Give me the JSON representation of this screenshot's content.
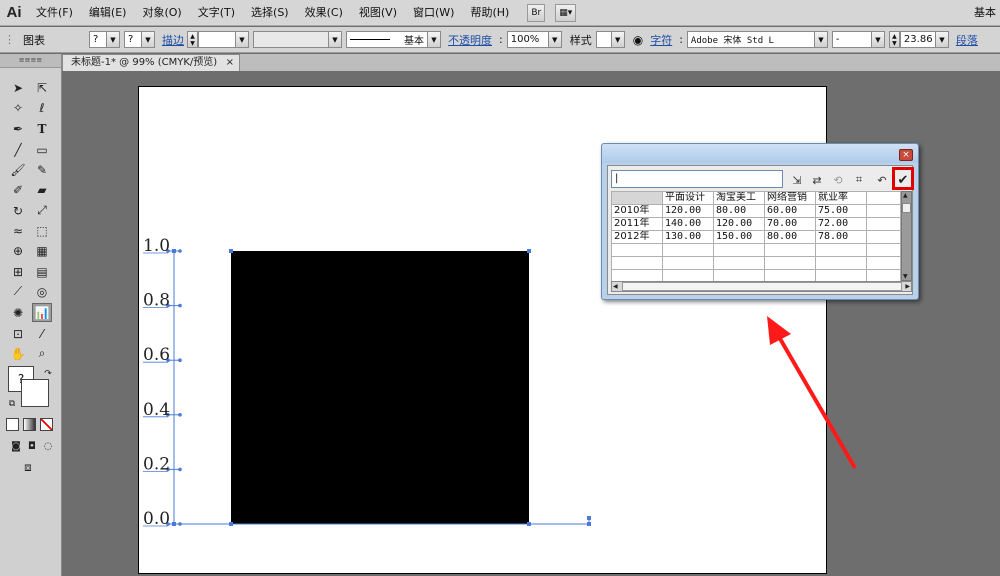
{
  "app": {
    "logo": "Ai",
    "workspace": "基本"
  },
  "menu": [
    {
      "key": "file",
      "label": "文件(F)"
    },
    {
      "key": "edit",
      "label": "编辑(E)"
    },
    {
      "key": "object",
      "label": "对象(O)"
    },
    {
      "key": "type",
      "label": "文字(T)"
    },
    {
      "key": "select",
      "label": "选择(S)"
    },
    {
      "key": "effect",
      "label": "效果(C)"
    },
    {
      "key": "view",
      "label": "视图(V)"
    },
    {
      "key": "window",
      "label": "窗口(W)"
    },
    {
      "key": "help",
      "label": "帮助(H)"
    }
  ],
  "menubar_buttons": {
    "bridge": "Br",
    "arrange": "▦▾"
  },
  "control": {
    "object_type": "图表",
    "fill_value": "?",
    "stroke_value": "?",
    "stroke_label": "描边",
    "stroke_style": "基本",
    "opacity_label": "不透明度",
    "opacity_value": "100%",
    "style_label": "样式",
    "char_label": "字符",
    "font_name": "Adobe 宋体 Std L",
    "font_style": "-",
    "font_size": "23.86",
    "para_label": "段落"
  },
  "document_tab": {
    "title": "未标题-1* @ 99% (CMYK/预览)",
    "close": "×"
  },
  "toolbox": {
    "grip": "≡≡≡≡",
    "fill_stroke_label": "?"
  },
  "graph_data_window": {
    "input_value": "|",
    "close": "×",
    "headers": [
      "",
      "平面设计",
      "淘宝美工",
      "网络营销",
      "就业率",
      ""
    ],
    "rows": [
      [
        "2010年",
        "120.00",
        "80.00",
        "60.00",
        "75.00",
        ""
      ],
      [
        "2011年",
        "140.00",
        "120.00",
        "70.00",
        "72.00",
        ""
      ],
      [
        "2012年",
        "130.00",
        "150.00",
        "80.00",
        "78.00",
        ""
      ],
      [
        "",
        "",
        "",
        "",
        "",
        ""
      ],
      [
        "",
        "",
        "",
        "",
        "",
        ""
      ],
      [
        "",
        "",
        "",
        "",
        "",
        ""
      ]
    ],
    "buttons": {
      "import": "⇲",
      "transpose": "⇄",
      "switch_xy": "⟲",
      "cell_style": "⌗",
      "revert": "↶",
      "apply": "✔"
    }
  },
  "chart_data": {
    "type": "bar",
    "categories": [
      ""
    ],
    "values": [
      1.0
    ],
    "ylim": [
      0,
      1.0
    ],
    "yticks": [
      "0.0",
      "0.2",
      "0.4",
      "0.6",
      "0.8",
      "1.0"
    ],
    "grid": false,
    "bar_color": "#000000",
    "selection_color": "#4a7bd8"
  },
  "annotation": {
    "arrow_color": "#ff1a1a"
  }
}
